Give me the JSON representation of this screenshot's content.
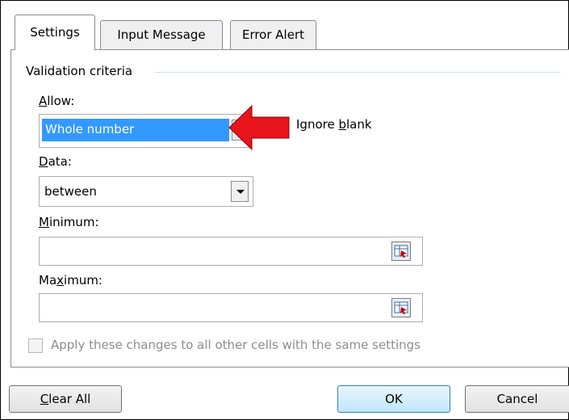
{
  "tabs": [
    {
      "label": "Settings",
      "active": true
    },
    {
      "label": "Input Message",
      "active": false
    },
    {
      "label": "Error Alert",
      "active": false
    }
  ],
  "section": {
    "title": "Validation criteria"
  },
  "allow": {
    "label_pre": "",
    "label_u": "A",
    "label_post": "llow:",
    "value": "Whole number"
  },
  "ignore_blank": {
    "label_pre": "Ignore ",
    "label_u": "b",
    "label_post": "lank",
    "checked": true
  },
  "data": {
    "label_u": "D",
    "label_post": "ata:",
    "value": "between"
  },
  "minimum": {
    "label_u": "M",
    "label_post": "inimum:",
    "value": ""
  },
  "maximum": {
    "label_pre": "Ma",
    "label_u": "x",
    "label_post": "imum:",
    "value": ""
  },
  "apply_all": {
    "label": "Apply these changes to all other cells with the same settings",
    "checked": false,
    "enabled": false
  },
  "buttons": {
    "clear_u": "C",
    "clear_post": "lear All",
    "ok": "OK",
    "cancel": "Cancel"
  },
  "colors": {
    "annotation_arrow": "#e8141b",
    "selection": "#3399ff"
  },
  "icons": [
    "dropdown-arrow-icon",
    "range-select-icon",
    "red-arrow-annotation"
  ]
}
